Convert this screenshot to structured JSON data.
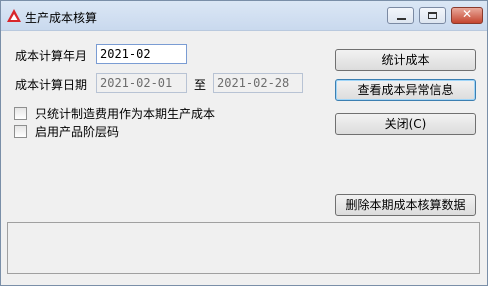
{
  "window": {
    "title": "生产成本核算",
    "close_glyph": "✕",
    "icon": "red-triangle-logo-icon"
  },
  "form": {
    "period_label": "成本计算年月",
    "period_value": "2021-02",
    "date_label": "成本计算日期",
    "date_from": "2021-02-01",
    "to_label": "至",
    "date_to": "2021-02-28",
    "checkbox1_label": "只统计制造费用作为本期生产成本",
    "checkbox1_checked": false,
    "checkbox2_label": "启用产品阶层码",
    "checkbox2_checked": false
  },
  "buttons": {
    "calc": "统计成本",
    "view_abnormal": "查看成本异常信息",
    "close": "关闭(C)",
    "delete": "删除本期成本核算数据"
  },
  "status": {
    "text": ""
  }
}
